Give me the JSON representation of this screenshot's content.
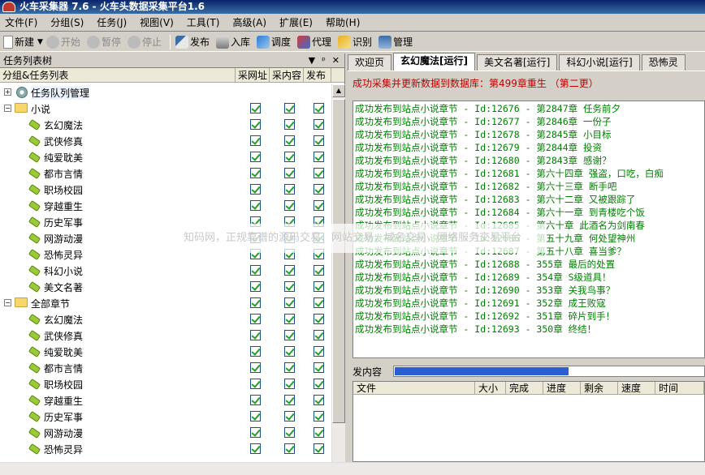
{
  "window": {
    "title": "火车采集器 7.6 - 火车头数据采集平台1.6"
  },
  "menu": [
    {
      "label": "文件(F)",
      "name": "menu-file"
    },
    {
      "label": "分组(S)",
      "name": "menu-group"
    },
    {
      "label": "任务(J)",
      "name": "menu-task"
    },
    {
      "label": "视图(V)",
      "name": "menu-view"
    },
    {
      "label": "工具(T)",
      "name": "menu-tools"
    },
    {
      "label": "高级(A)",
      "name": "menu-advanced"
    },
    {
      "label": "扩展(E)",
      "name": "menu-extend"
    },
    {
      "label": "帮助(H)",
      "name": "menu-help"
    }
  ],
  "toolbar": {
    "new": "新建",
    "start": "开始",
    "pause": "暂停",
    "stop": "停止",
    "publish": "发布",
    "import": "入库",
    "schedule": "调度",
    "proxy": "代理",
    "recognize": "识别",
    "manage": "管理"
  },
  "left_panel": {
    "title": "任务列表树",
    "controls": [
      "▼",
      "ᵖ",
      "✕"
    ],
    "columns": [
      "分组&任务列表",
      "采网址",
      "采内容",
      "发布"
    ],
    "queue_root": "任务队列管理",
    "groups": [
      {
        "label": "小说",
        "items": [
          "玄幻魔法",
          "武侠修真",
          "纯爱耽美",
          "都市言情",
          "职场校园",
          "穿越重生",
          "历史军事",
          "网游动漫",
          "恐怖灵异",
          "科幻小说",
          "美文名著"
        ]
      },
      {
        "label": "全部章节",
        "items": [
          "玄幻魔法",
          "武侠修真",
          "纯爱耽美",
          "都市言情",
          "职场校园",
          "穿越重生",
          "历史军事",
          "网游动漫",
          "恐怖灵异"
        ]
      }
    ]
  },
  "right_panel": {
    "tabs": [
      "欢迎页",
      "玄幻魔法[运行]",
      "美文名著[运行]",
      "科幻小说[运行]",
      "恐怖灵"
    ],
    "active_tab": 1,
    "status": "成功采集并更新数据到数据库：第499章重生 （第二更）",
    "log_lines": [
      "成功发布到站点小说章节 - Id:12676 - 第2847章 任务前夕",
      "成功发布到站点小说章节 - Id:12677 - 第2846章 一份子",
      "成功发布到站点小说章节 - Id:12678 - 第2845章 小目标",
      "成功发布到站点小说章节 - Id:12679 - 第2844章 投资",
      "成功发布到站点小说章节 - Id:12680 - 第2843章 感谢？",
      "成功发布到站点小说章节 - Id:12681 - 第六十四章 强盗，口吃，白痴",
      "成功发布到站点小说章节 - Id:12682 - 第六十三章 断手吧",
      "成功发布到站点小说章节 - Id:12683 - 第六十二章 又被跟踪了",
      "成功发布到站点小说章节 - Id:12684 - 第六十一章 到青楼吃个饭",
      "成功发布到站点小说章节 - Id:12685 - 第六十章 此酒名为剑南春",
      "成功发布到站点小说章节 - Id:12686 - 第五十九章 何处望神州",
      "成功发布到站点小说章节 - Id:12687 - 第五十八章 喜当爹？",
      "成功发布到站点小说章节 - Id:12688 - 355章 最后的处置",
      "成功发布到站点小说章节 - Id:12689 - 354章 S级道具！",
      "成功发布到站点小说章节 - Id:12690 - 353章 关我鸟事？",
      "成功发布到站点小说章节 - Id:12691 - 352章 成王败寇",
      "成功发布到站点小说章节 - Id:12692 - 351章 碎片到手！",
      "成功发布到站点小说章节 - Id:12693 - 350章 终结！"
    ],
    "progress_label": "发内容",
    "progress_fraction": 0.56,
    "file_columns": [
      "文件",
      "大小",
      "完成",
      "进度",
      "剩余",
      "速度",
      "时间"
    ]
  },
  "watermark": "知码网，正规靠谱的源码交易、网站交易，域名交易，网络服务交易平台",
  "colors": {
    "log_text": "#008000",
    "status_text": "#c00000",
    "checkbox_check": "#21a121",
    "progress_fill": "#2a5fd4"
  }
}
